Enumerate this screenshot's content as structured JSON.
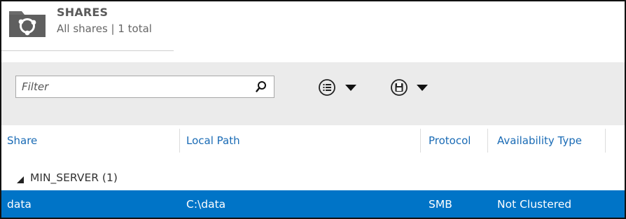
{
  "header": {
    "title": "SHARES",
    "subtitle": "All shares | 1 total",
    "icon": "shares-folder-icon"
  },
  "toolbar": {
    "filter_placeholder": "Filter",
    "filter_value": "",
    "search_icon": "search-icon",
    "tasks_icon": "list-view-icon",
    "save_icon": "save-query-icon"
  },
  "table": {
    "columns": [
      "Share",
      "Local Path",
      "Protocol",
      "Availability Type"
    ],
    "groups": [
      {
        "label": "MIN_SERVER (1)",
        "expanded": true,
        "rows": [
          {
            "share": "data",
            "local_path": "C:\\data",
            "protocol": "SMB",
            "availability": "Not Clustered",
            "selected": true
          }
        ]
      }
    ]
  },
  "colors": {
    "accent": "#1a6bb5",
    "selection": "#0074c7",
    "toolbar_bg": "#ebebeb"
  }
}
